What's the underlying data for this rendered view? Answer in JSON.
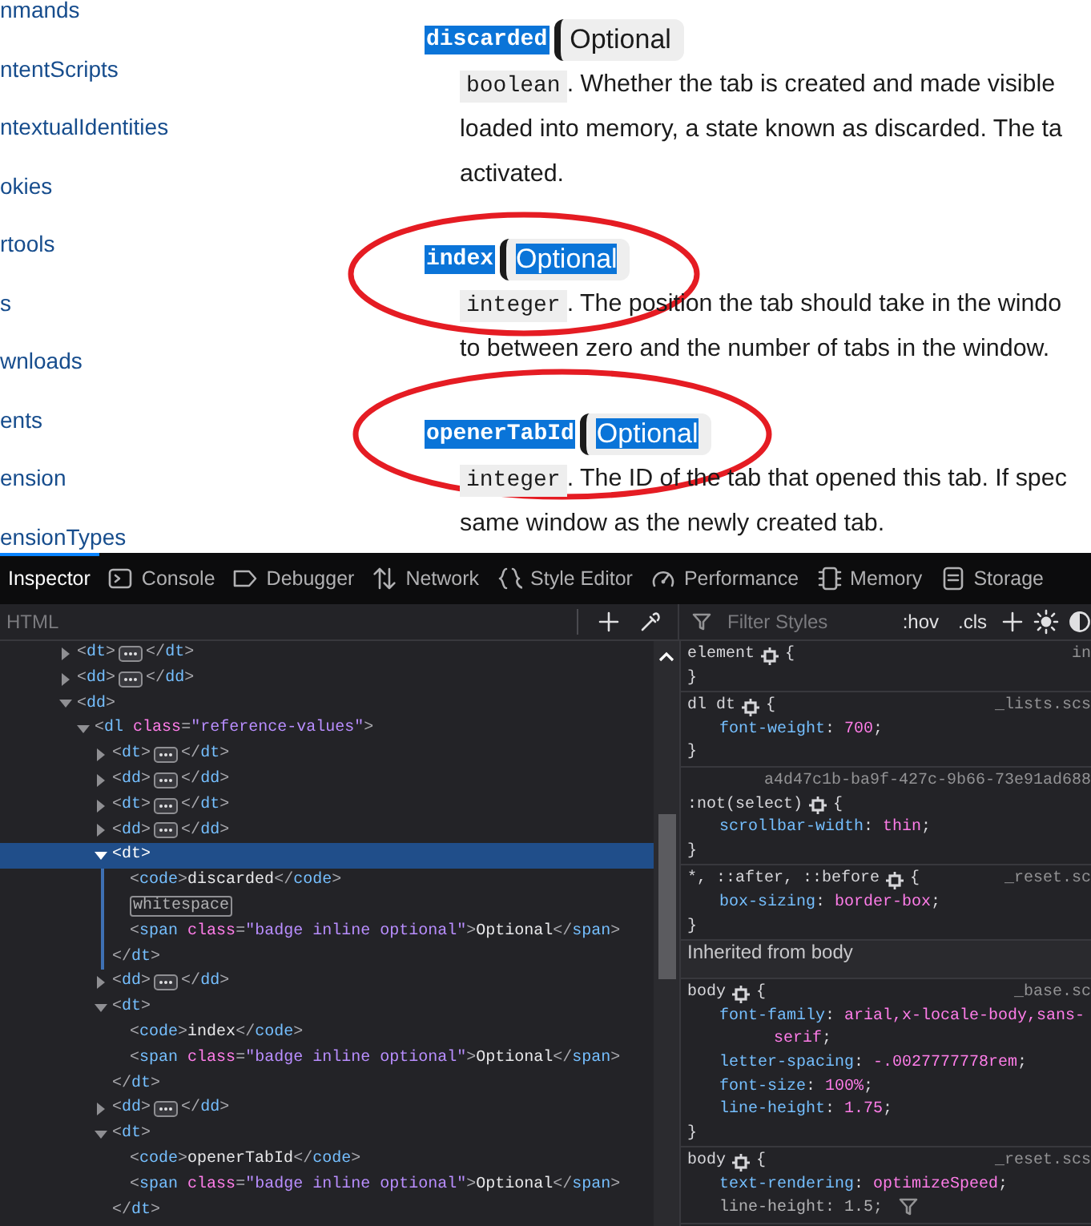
{
  "sidebar": {
    "links": [
      "nmands",
      "ntentScripts",
      "ntextualIdentities",
      "okies",
      "rtools",
      "s",
      "wnloads",
      "ents",
      "ension",
      "ensionTypes"
    ]
  },
  "content": {
    "items": [
      {
        "name": "discarded",
        "badge": "Optional",
        "badge_highlighted": false,
        "type": "boolean",
        "lines": [
          ". Whether the tab is created and made visible",
          "loaded into memory, a state known as discarded. The ta",
          "activated."
        ]
      },
      {
        "name": "index",
        "badge": "Optional",
        "badge_highlighted": true,
        "type": "integer",
        "lines": [
          ". The position the tab should take in the windo",
          "to between zero and the number of tabs in the window."
        ]
      },
      {
        "name": "openerTabId",
        "badge": "Optional",
        "badge_highlighted": true,
        "type": "integer",
        "lines": [
          ". The ID of the tab that opened this tab. If spec",
          "same window as the newly created tab."
        ]
      }
    ]
  },
  "devtools": {
    "tabs": [
      {
        "label": "Inspector",
        "selected": true
      },
      {
        "label": "Console",
        "selected": false
      },
      {
        "label": "Debugger",
        "selected": false
      },
      {
        "label": "Network",
        "selected": false
      },
      {
        "label": "Style Editor",
        "selected": false
      },
      {
        "label": "Performance",
        "selected": false
      },
      {
        "label": "Memory",
        "selected": false
      },
      {
        "label": "Storage",
        "selected": false
      }
    ],
    "markup_search": {
      "placeholder": "HTML"
    },
    "rules_filter": {
      "placeholder": "Filter Styles"
    },
    "rules_toggles": [
      ":hov",
      ".cls"
    ],
    "tree": [
      {
        "kind": "element",
        "open": "<dt>",
        "close": "</dt>",
        "expanded": false,
        "selected": false
      },
      {
        "kind": "element",
        "open": "<dd>",
        "close": "</dd>",
        "expanded": false,
        "selected": false
      },
      {
        "kind": "element",
        "open": "<dd>",
        "expanded": true,
        "selected": false,
        "children": [
          {
            "kind": "element",
            "open": "<dl class=\"reference-values\">",
            "expanded": true,
            "selected": false,
            "children": [
              {
                "kind": "element",
                "open": "<dt>",
                "close": "</dt>",
                "expanded": false,
                "selected": false
              },
              {
                "kind": "element",
                "open": "<dd>",
                "close": "</dd>",
                "expanded": false,
                "selected": false
              },
              {
                "kind": "element",
                "open": "<dt>",
                "close": "</dt>",
                "expanded": false,
                "selected": false
              },
              {
                "kind": "element",
                "open": "<dd>",
                "close": "</dd>",
                "expanded": false,
                "selected": false
              },
              {
                "kind": "element",
                "open": "<dt>",
                "close": "</dt>",
                "expanded": true,
                "selected": true,
                "children": [
                  {
                    "kind": "leaf",
                    "text": "<code>discarded</code>",
                    "selected": false
                  },
                  {
                    "kind": "whitespace",
                    "text": "whitespace",
                    "selected": false
                  },
                  {
                    "kind": "leaf",
                    "text": "<span class=\"badge inline optional\">Optional</span>",
                    "selected": false
                  }
                ]
              },
              {
                "kind": "element",
                "open": "<dd>",
                "close": "</dd>",
                "expanded": false,
                "selected": false
              },
              {
                "kind": "element",
                "open": "<dt>",
                "close": "</dt>",
                "expanded": true,
                "selected": false,
                "children": [
                  {
                    "kind": "leaf",
                    "text": "<code>index</code>",
                    "selected": false
                  },
                  {
                    "kind": "leaf",
                    "text": "<span class=\"badge inline optional\">Optional</span>",
                    "selected": false
                  }
                ]
              },
              {
                "kind": "element",
                "open": "<dd>",
                "close": "</dd>",
                "expanded": false,
                "selected": false
              },
              {
                "kind": "element",
                "open": "<dt>",
                "close": "</dt>",
                "expanded": true,
                "selected": false,
                "children": [
                  {
                    "kind": "leaf",
                    "text": "<code>openerTabId</code>",
                    "selected": false
                  },
                  {
                    "kind": "leaf",
                    "text": "<span class=\"badge inline optional\">Optional</span>",
                    "selected": false
                  }
                ]
              }
            ]
          }
        ]
      }
    ],
    "rules": [
      {
        "kind": "rule",
        "selector": "element",
        "source": "in",
        "open": "{",
        "close": "}"
      },
      {
        "kind": "rule",
        "selector": "dl dt",
        "source": "_lists.scs",
        "open": "{",
        "close": "}",
        "declarations": [
          {
            "text": "font-weight: 700;",
            "overridden": false
          }
        ]
      },
      {
        "kind": "rule",
        "selector": ":not(select)",
        "source": "a4d47c1b-ba9f-427c-9b66-73e91ad688",
        "open": "{",
        "close": "}",
        "declarations": [
          {
            "text": "scrollbar-width: thin;",
            "overridden": false
          }
        ]
      },
      {
        "kind": "rule",
        "selector": "*, ::after, ::before",
        "source": "_reset.sc",
        "open": "{",
        "close": "}",
        "declarations": [
          {
            "text": "box-sizing: border-box;",
            "overridden": false
          }
        ]
      },
      {
        "kind": "header",
        "text": "Inherited from body"
      },
      {
        "kind": "rule",
        "selector": "body",
        "source": "_base.sc",
        "open": "{",
        "close": "}",
        "declarations": [
          {
            "text": "font-family: arial,x-locale-body,sans-serif;",
            "overridden": false
          },
          {
            "text": "letter-spacing: -.0027777778rem;",
            "overridden": false
          },
          {
            "text": "font-size: 100%;",
            "overridden": false
          },
          {
            "text": "line-height: 1.75;",
            "overridden": false
          }
        ]
      },
      {
        "kind": "rule",
        "selector": "body",
        "source": "_reset.scs",
        "open": "{",
        "declarations": [
          {
            "text": "text-rendering: optimizeSpeed;",
            "overridden": false
          },
          {
            "text": "line-height: 1.5;",
            "overridden": true
          }
        ]
      }
    ]
  }
}
